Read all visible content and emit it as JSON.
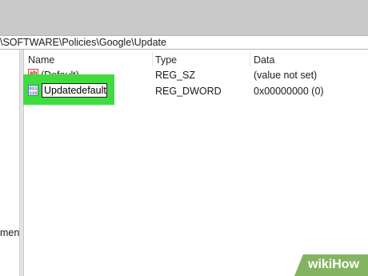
{
  "address_bar": {
    "path": "\\SOFTWARE\\Policies\\Google\\Update"
  },
  "tree": {
    "truncated_label": "ment"
  },
  "values_pane": {
    "columns": [
      "Name",
      "Type",
      "Data"
    ],
    "rows": [
      {
        "name": "(Default)",
        "type": "REG_SZ",
        "data": "(value not set)",
        "icon": "string-value-icon"
      },
      {
        "name": "Updatedefault",
        "type": "REG_DWORD",
        "data": "0x00000000 (0)",
        "icon": "binary-value-icon",
        "editing": true
      }
    ]
  },
  "icons": {
    "string_icon_glyph": "ab",
    "binary_icon_glyph": "011\n110"
  },
  "watermark": {
    "text": "wikiHow"
  },
  "colors": {
    "highlight": "#3fdc3f",
    "watermark": "#79ad55"
  }
}
